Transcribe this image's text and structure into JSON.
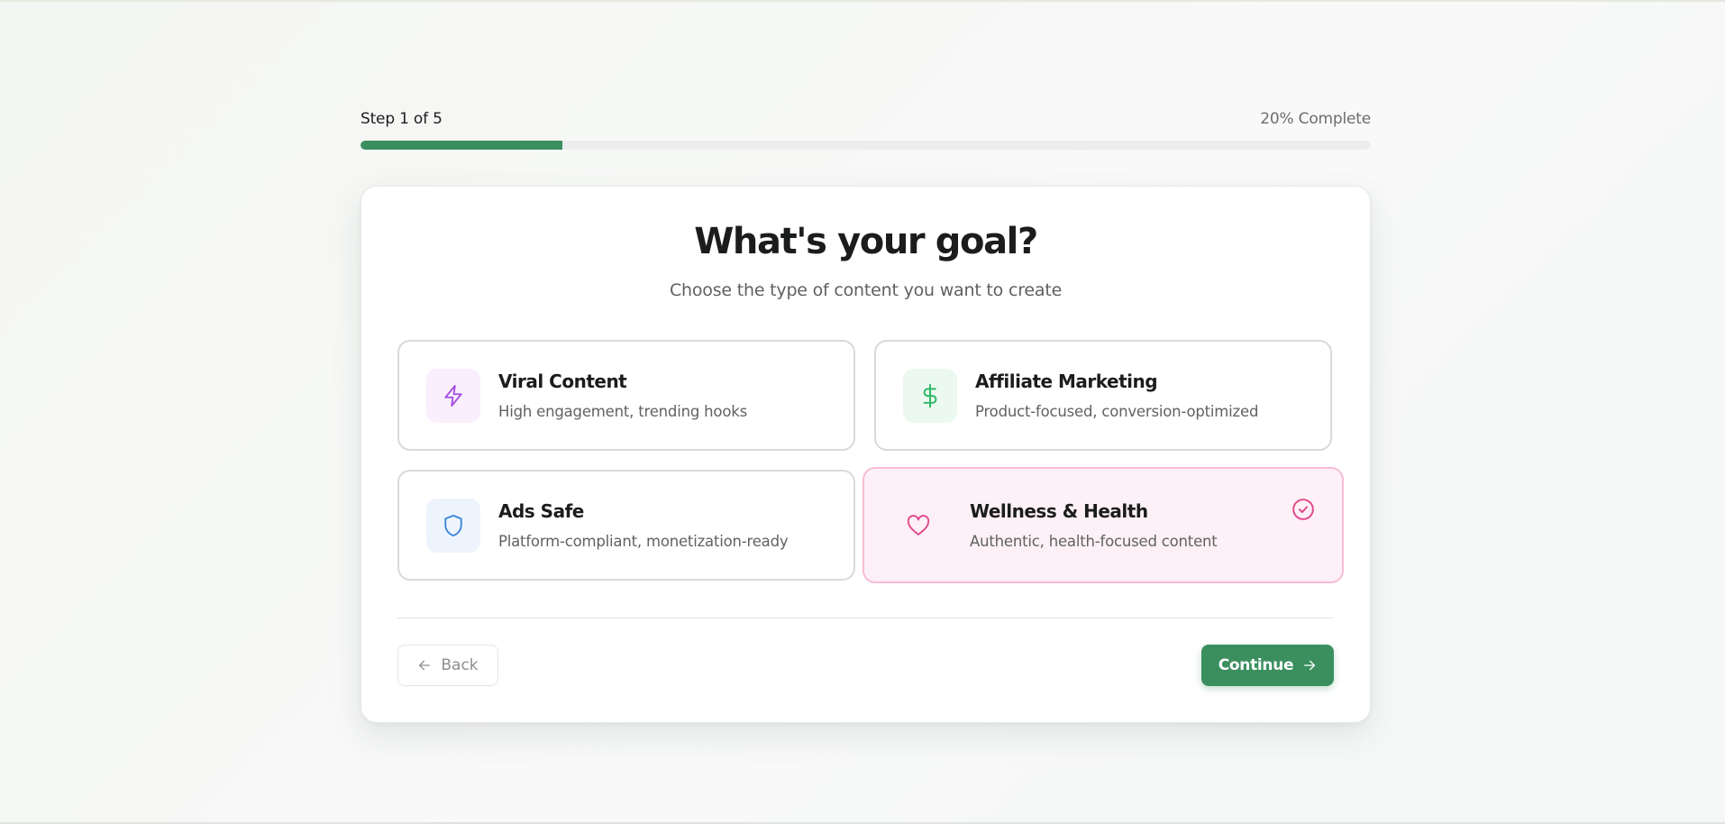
{
  "progress": {
    "step_label": "Step 1 of 5",
    "percent_label": "20% Complete",
    "fraction": 0.2
  },
  "card": {
    "title": "What's your goal?",
    "subtitle": "Choose the type of content you want to create"
  },
  "options": [
    {
      "title": "Viral Content",
      "description": "High engagement, trending hooks",
      "icon": "lightning-icon",
      "icon_color": "#a54de0",
      "icon_bg": "#f9effd",
      "selected": false
    },
    {
      "title": "Affiliate Marketing",
      "description": "Product-focused, conversion-optimized",
      "icon": "dollar-icon",
      "icon_color": "#2fb866",
      "icon_bg": "#ebf9f0",
      "selected": false
    },
    {
      "title": "Ads Safe",
      "description": "Platform-compliant, monetization-ready",
      "icon": "shield-icon",
      "icon_color": "#3c86d8",
      "icon_bg": "#edf4fd",
      "selected": false
    },
    {
      "title": "Wellness & Health",
      "description": "Authentic, health-focused content",
      "icon": "heart-icon",
      "icon_color": "#e2468b",
      "icon_bg": "#fdf0f6",
      "selected": true
    }
  ],
  "footer": {
    "back_label": "Back",
    "continue_label": "Continue",
    "back_icon": "arrow-left-icon",
    "continue_icon": "arrow-right-icon"
  },
  "colors": {
    "accent": "#3b8f5f",
    "selected_border": "#f7bcd6",
    "selected_bg": "#fdf0f6",
    "selected_check": "#e2468b"
  }
}
